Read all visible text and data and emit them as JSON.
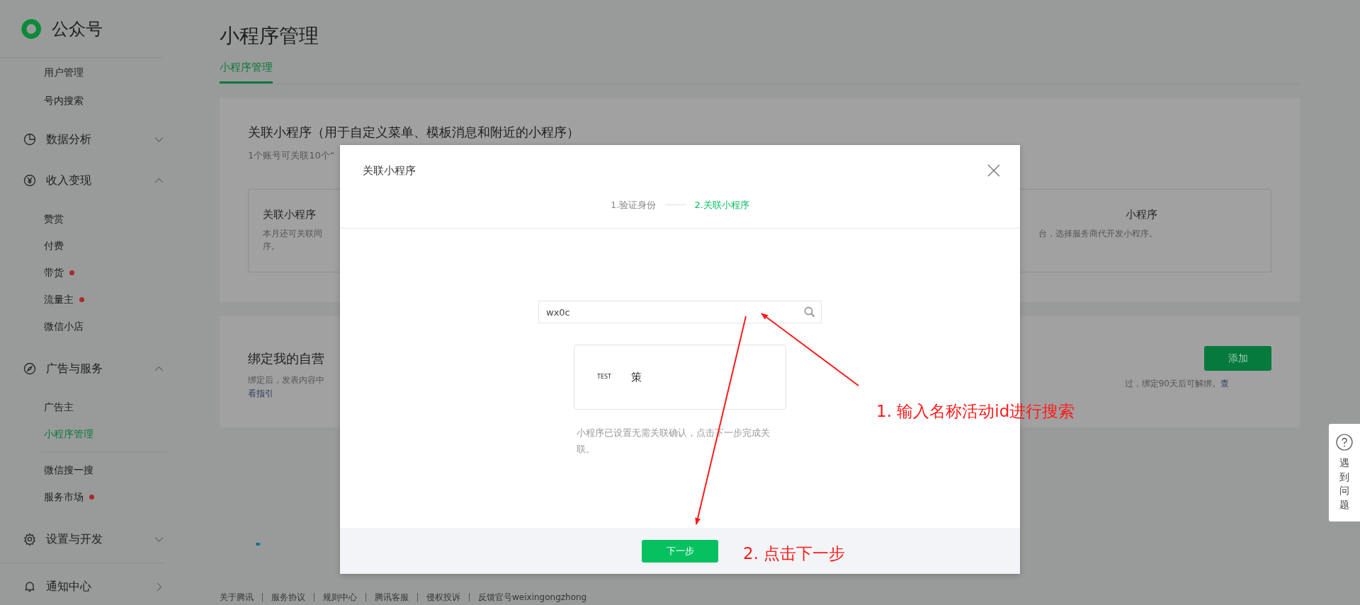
{
  "sidebar": {
    "logo_text": "公众号",
    "items": [
      {
        "kind": "sub",
        "label": "用户管理",
        "selected": false
      },
      {
        "kind": "sub",
        "label": "号内搜索",
        "selected": false
      },
      {
        "kind": "group",
        "label": "数据分析",
        "expanded": false
      },
      {
        "kind": "group",
        "label": "收入变现",
        "expanded": true,
        "children": [
          {
            "label": "赞赏",
            "selected": false,
            "dot": false
          },
          {
            "label": "付费",
            "selected": false,
            "dot": false
          },
          {
            "label": "带货",
            "selected": false,
            "dot": true
          },
          {
            "label": "流量主",
            "selected": false,
            "dot": true
          },
          {
            "label": "微信小店",
            "selected": false,
            "dot": false
          }
        ]
      },
      {
        "kind": "group",
        "label": "广告与服务",
        "expanded": true,
        "children": [
          {
            "label": "广告主",
            "selected": false,
            "dot": false
          },
          {
            "label": "小程序管理",
            "selected": true,
            "dot": false
          },
          {
            "kind": "divider"
          },
          {
            "label": "微信搜一搜",
            "selected": false,
            "dot": false
          },
          {
            "label": "服务市场",
            "selected": false,
            "dot": true
          }
        ]
      },
      {
        "kind": "group",
        "label": "设置与开发",
        "expanded": false
      },
      {
        "kind": "divider"
      },
      {
        "kind": "link",
        "label": "通知中心"
      }
    ]
  },
  "page_title": "小程序管理",
  "tabs": [
    {
      "label": "小程序管理",
      "selected": true
    }
  ],
  "link_card": {
    "title": "关联小程序（用于自定义菜单、模板消息和附近的小程序）",
    "subtitle": "1个账号可关联10个“",
    "options": [
      {
        "title": "关联小程序",
        "description_lines": [
          "本月还可关联同",
          "序。"
        ]
      },
      {
        "title": "小程序",
        "description_lines": [
          "台，选择服务商代开发小程序。"
        ]
      }
    ]
  },
  "bind_card": {
    "title": "绑定我的自营",
    "description": "绑定后，发表内容中",
    "link_head": "看指引",
    "right_text": "过，绑定90天后可解绑。",
    "link_tail": "查",
    "button": "添加"
  },
  "footer_links": [
    "关于腾讯",
    "服务协议",
    "规则中心",
    "腾讯客服",
    "侵权投诉",
    "反馈官号weixingongzhong"
  ],
  "modal": {
    "title": "关联小程序",
    "steps": [
      {
        "label": "1.验证身份",
        "selected": false
      },
      {
        "label": "2.关联小程序",
        "selected": true
      }
    ],
    "search": {
      "value": "wx0c"
    },
    "result": {
      "logo": "TEST",
      "name": "策"
    },
    "note": "小程序已设置无需关联确认，点击下一步完成关联。",
    "next_button": "下一步"
  },
  "help": {
    "label": "遇到问题"
  },
  "annotations": [
    {
      "text": "1. 输入名称活动id进行搜索"
    },
    {
      "text": "2. 点击下一步"
    }
  ]
}
